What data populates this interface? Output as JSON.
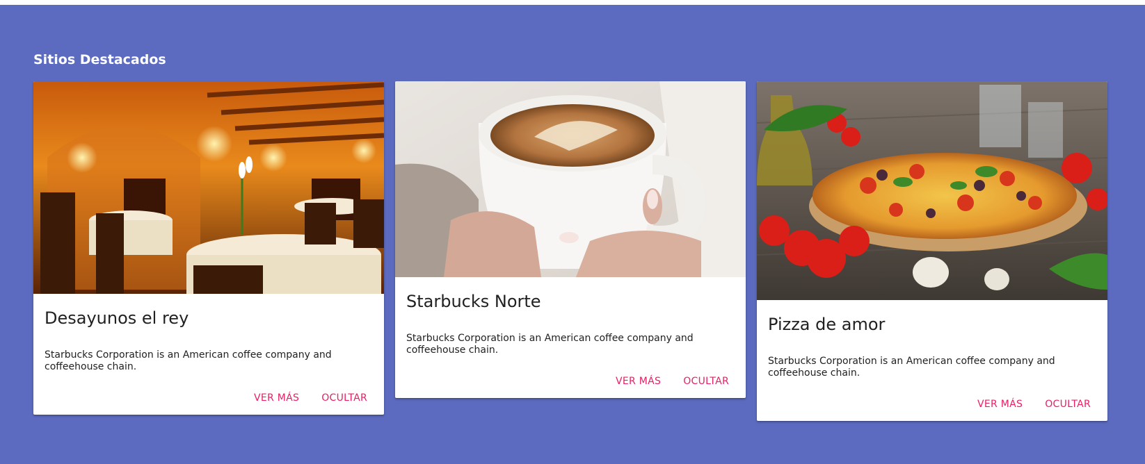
{
  "section": {
    "title": "Sitios Destacados",
    "background": "#5c6bc0"
  },
  "cards": [
    {
      "title": "Desayunos el rey",
      "description": "Starbucks Corporation is an American coffee company and coffeehouse chain.",
      "image": "restaurant-dining-room",
      "actions": {
        "more": "VER MÁS",
        "hide": "OCULTAR"
      }
    },
    {
      "title": "Starbucks Norte",
      "description": "Starbucks Corporation is an American coffee company and coffeehouse chain.",
      "image": "coffee-cup-hands",
      "actions": {
        "more": "VER MÁS",
        "hide": "OCULTAR"
      }
    },
    {
      "title": "Pizza de amor",
      "description": "Starbucks Corporation is an American coffee company and coffeehouse chain.",
      "image": "pizza-with-tomatoes",
      "actions": {
        "more": "VER MÁS",
        "hide": "OCULTAR"
      }
    }
  ],
  "colors": {
    "accent": "#e91e63",
    "card_background": "#ffffff",
    "text": "#212121"
  }
}
